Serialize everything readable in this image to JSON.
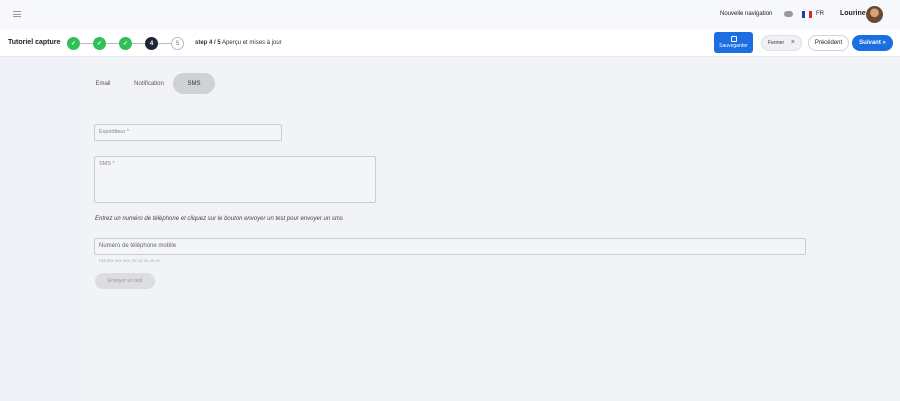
{
  "header": {
    "nav_label": "Nouvelle navigation",
    "lang": "FR",
    "user": "Lourine"
  },
  "stepper": {
    "title": "Tutoriel capture",
    "steps": [
      {
        "label": "",
        "state": "done"
      },
      {
        "label": "",
        "state": "done"
      },
      {
        "label": "",
        "state": "done"
      },
      {
        "label": "4",
        "state": "current"
      },
      {
        "label": "5",
        "state": "todo"
      }
    ],
    "step_prefix": "step 4 / 5",
    "step_desc": "Aperçu et mises à jour",
    "save_label": "Sauvegarder",
    "close_label": "Fermer",
    "prev_label": "Précédent",
    "next_label": "Suivant »"
  },
  "tabs": [
    {
      "label": "Email",
      "active": false
    },
    {
      "label": "Notification",
      "active": false
    },
    {
      "label": "SMS",
      "active": true
    }
  ],
  "form": {
    "sender_label": "Expéditeur *",
    "sms_label": "SMS *",
    "help_text": "Entrez un numéro de téléphone et cliquez sur le bouton envoyer un test pour envoyer un sms",
    "phone_placeholder": "Numéro de téléphone mobile",
    "phone_hint": "+33 xxx xxx xxx, 0x xx xx xx xx",
    "test_button": "Envoyer un test"
  },
  "colors": {
    "primary": "#1b6fe0",
    "success": "#2fc05a",
    "current_step": "#1f2433"
  }
}
